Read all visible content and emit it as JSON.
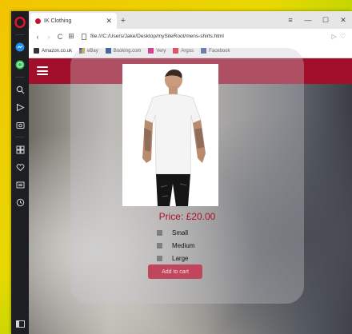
{
  "tab": {
    "title": "IK Clothing",
    "new_tab": "+"
  },
  "window_controls": {
    "menu": "≡",
    "minimize": "—",
    "maximize": "☐",
    "close": "✕"
  },
  "address": {
    "url": "file:///C:/Users/Jake/Desktop/mySiteRoot/mens-shirts.html"
  },
  "nav": {
    "back": "‹",
    "forward": "›",
    "reload": "C",
    "grid": "⊞"
  },
  "bookmarks": [
    {
      "label": "Amazon.co.uk",
      "color": "#333333"
    },
    {
      "label": "eBay",
      "color": "#e53238"
    },
    {
      "label": "Booking.com",
      "color": "#003580"
    },
    {
      "label": "Very",
      "color": "#d6006f"
    },
    {
      "label": "Argos",
      "color": "#e3182d"
    },
    {
      "label": "Facebook",
      "color": "#3b5998"
    }
  ],
  "product": {
    "price": "Price: £20.00",
    "sizes": [
      "Small",
      "Medium",
      "Large"
    ],
    "add_to_cart": "Add to cart"
  },
  "colors": {
    "brand": "#a10f2b",
    "price": "#b00d2c",
    "button": "#c0465e"
  }
}
